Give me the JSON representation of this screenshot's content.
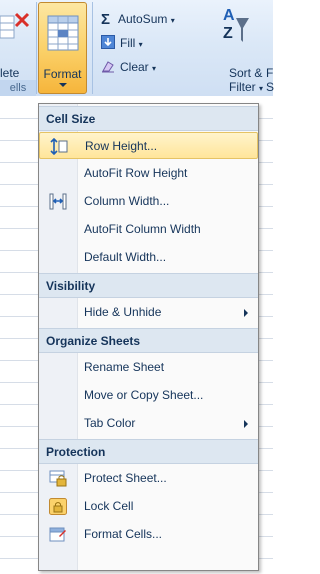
{
  "ribbon": {
    "delete_label": "lete",
    "cells_group_label": "ells",
    "format_label": "Format",
    "autosum_label": "AutoSum",
    "fill_label": "Fill",
    "clear_label": "Clear",
    "sort_filter_line1": "Sort &",
    "sort_filter_line2": "Filter",
    "find_line1": "F",
    "find_line2": "S"
  },
  "menu": {
    "sections": [
      {
        "header": "Cell Size",
        "items": [
          {
            "label": "Row Height...",
            "icon": "row-height-icon",
            "highlighted": true
          },
          {
            "label": "AutoFit Row Height"
          },
          {
            "label": "Column Width...",
            "icon": "column-width-icon"
          },
          {
            "label": "AutoFit Column Width"
          },
          {
            "label": "Default Width..."
          }
        ]
      },
      {
        "header": "Visibility",
        "items": [
          {
            "label": "Hide & Unhide",
            "submenu": true
          }
        ]
      },
      {
        "header": "Organize Sheets",
        "items": [
          {
            "label": "Rename Sheet"
          },
          {
            "label": "Move or Copy Sheet..."
          },
          {
            "label": "Tab Color",
            "submenu": true
          }
        ]
      },
      {
        "header": "Protection",
        "items": [
          {
            "label": "Protect Sheet...",
            "icon": "protect-sheet-icon"
          },
          {
            "label": "Lock Cell",
            "icon": "lock-icon"
          },
          {
            "label": "Format Cells...",
            "icon": "format-cells-icon"
          }
        ]
      }
    ]
  },
  "colors": {
    "highlight": "#ffe59a",
    "header_bg": "#dde7f1",
    "text": "#15345a",
    "ribbon_bg": "#dbe8f7"
  }
}
